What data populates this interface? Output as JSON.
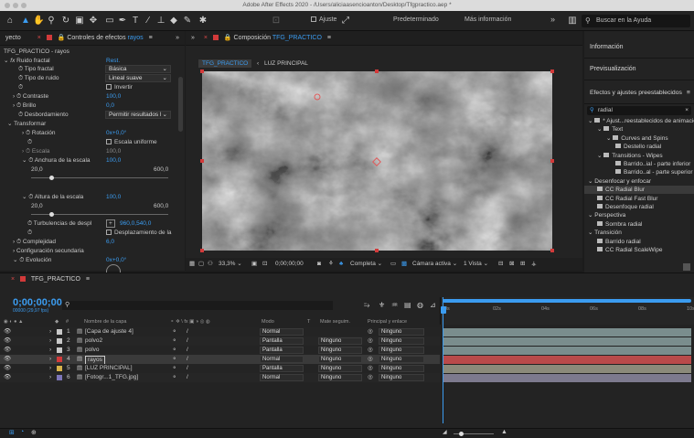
{
  "window": {
    "title": "Adobe After Effects 2020 - /Users/aliciaasencioanton/Desktop/Tfgpractico.aep *"
  },
  "toolbar": {
    "adjust_label": "Ajuste",
    "workspace_default": "Predeterminado",
    "workspace_more": "Más información",
    "overflow": "»",
    "search_placeholder": "Buscar en la Ayuda"
  },
  "effects_panel": {
    "left_tab": "yecto",
    "tab_title": "Controles de efectos",
    "tab_layer": "rayos",
    "breadcrumb": "TFG_PRACTICO - rayos",
    "effect_name": "Ruido fractal",
    "reset": "Rest.",
    "props": {
      "tipo_fractal": "Tipo fractal",
      "tipo_fractal_val": "Básica",
      "tipo_ruido": "Tipo de ruido",
      "tipo_ruido_val": "Lineal suave",
      "invertir": "Invertir",
      "contraste": "Contraste",
      "contraste_val": "100,0",
      "brillo": "Brillo",
      "brillo_val": "0,0",
      "desbordamiento": "Desbordamiento",
      "desbordamiento_val": "Permitir resultados l",
      "transformar": "Transformar",
      "rotacion": "Rotación",
      "rotacion_val": "0x+0,0°",
      "escala_uniforme": "Escala uniforme",
      "escala": "Escala",
      "escala_val": "100,0",
      "anchura": "Anchura de la escala",
      "anchura_val": "100,0",
      "slider_min": "20,0",
      "slider_max": "600,0",
      "altura": "Altura de la escala",
      "altura_val": "100,0",
      "turbulencias": "Turbulencias de despl",
      "turbulencias_val": "960,0,540,0",
      "desplazamiento": "Desplazamiento de la",
      "complejidad": "Complejidad",
      "complejidad_val": "6,0",
      "config_secundaria": "Configuración secundaria",
      "evolucion": "Evolución",
      "evolucion_val": "0x+0,0°"
    }
  },
  "composition": {
    "tab_prefix": "Composición",
    "tab_name": "TFG_PRACTICO",
    "crumb_active": "TFG_PRACTICO",
    "crumb_next": "LUZ PRINCIPAL",
    "zoom": "33,3%",
    "timecode": "0;00;00;00",
    "quality": "Completa",
    "camera": "Cámara activa",
    "views": "1 Vista"
  },
  "right_panel": {
    "info": "Información",
    "preview": "Previsualización",
    "effects_title": "Efectos y ajustes preestablecidos",
    "search_value": "radial",
    "tree": [
      {
        "label": "* Ajust...reestablecidos de animación",
        "indent": 0,
        "type": "folder"
      },
      {
        "label": "Text",
        "indent": 1,
        "type": "folder"
      },
      {
        "label": "Curves and Spins",
        "indent": 2,
        "type": "folder"
      },
      {
        "label": "Destello radial",
        "indent": 3,
        "type": "preset"
      },
      {
        "label": "Transitions - Wipes",
        "indent": 1,
        "type": "folder"
      },
      {
        "label": "Barrido..ial - parte inferior",
        "indent": 3,
        "type": "preset"
      },
      {
        "label": "Barrido..al - parte superior",
        "indent": 3,
        "type": "preset"
      },
      {
        "label": "Desenfocar y enfocar",
        "indent": 0,
        "type": "category"
      },
      {
        "label": "CC Radial Blur",
        "indent": 1,
        "type": "effect",
        "selected": true
      },
      {
        "label": "CC Radial Fast Blur",
        "indent": 1,
        "type": "effect"
      },
      {
        "label": "Desenfoque radial",
        "indent": 1,
        "type": "effect"
      },
      {
        "label": "Perspectiva",
        "indent": 0,
        "type": "category"
      },
      {
        "label": "Sombra radial",
        "indent": 1,
        "type": "effect"
      },
      {
        "label": "Transición",
        "indent": 0,
        "type": "category"
      },
      {
        "label": "Barrido radial",
        "indent": 1,
        "type": "effect"
      },
      {
        "label": "CC Radial ScaleWipe",
        "indent": 1,
        "type": "effect"
      }
    ]
  },
  "timeline": {
    "tab": "TFG_PRACTICO",
    "timecode": "0;00;00;00",
    "timecode_sub": "00000 (29,97 fps)",
    "headers": {
      "num": "#",
      "name": "Nombre de la capa",
      "mode": "Modo",
      "t": "T",
      "matte": "Mate seguim.",
      "parent": "Principal y enlace"
    },
    "ruler": [
      "0s",
      "02s",
      "04s",
      "06s",
      "08s",
      "10s"
    ],
    "layers": [
      {
        "num": "1",
        "name": "[Capa de ajuste 4]",
        "mode": "Normal",
        "matte": "",
        "parent": "Ninguno",
        "color": "#c9c9c9",
        "bar": "#7a8d8d",
        "selected": false
      },
      {
        "num": "2",
        "name": "polvo2",
        "mode": "Pantalla",
        "matte": "Ninguno",
        "parent": "Ninguno",
        "color": "#c9c9c9",
        "bar": "#7a8d8d",
        "selected": false
      },
      {
        "num": "3",
        "name": "polvo",
        "mode": "Pantalla",
        "matte": "Ninguno",
        "parent": "Ninguno",
        "color": "#c9c9c9",
        "bar": "#7a8d8d",
        "selected": false
      },
      {
        "num": "4",
        "name": "rayos",
        "mode": "Normal",
        "matte": "Ninguno",
        "parent": "Ninguno",
        "color": "#d23a3a",
        "bar": "#b94a4a",
        "selected": true
      },
      {
        "num": "5",
        "name": "[LUZ PRINCIPAL]",
        "mode": "Pantalla",
        "matte": "Ninguno",
        "parent": "Ninguno",
        "color": "#d6b24a",
        "bar": "#8b8a7a",
        "selected": false
      },
      {
        "num": "6",
        "name": "[Fotogr...1_TFG.jpg]",
        "mode": "Normal",
        "matte": "Ninguno",
        "parent": "Ninguno",
        "color": "#7d76b9",
        "bar": "#7d7a8e",
        "selected": false
      }
    ]
  },
  "colors": {
    "accent": "#3b9cf0",
    "panel_bg": "#232323",
    "header_bg": "#1f1f1f",
    "selected_row": "#3a3a3a"
  }
}
